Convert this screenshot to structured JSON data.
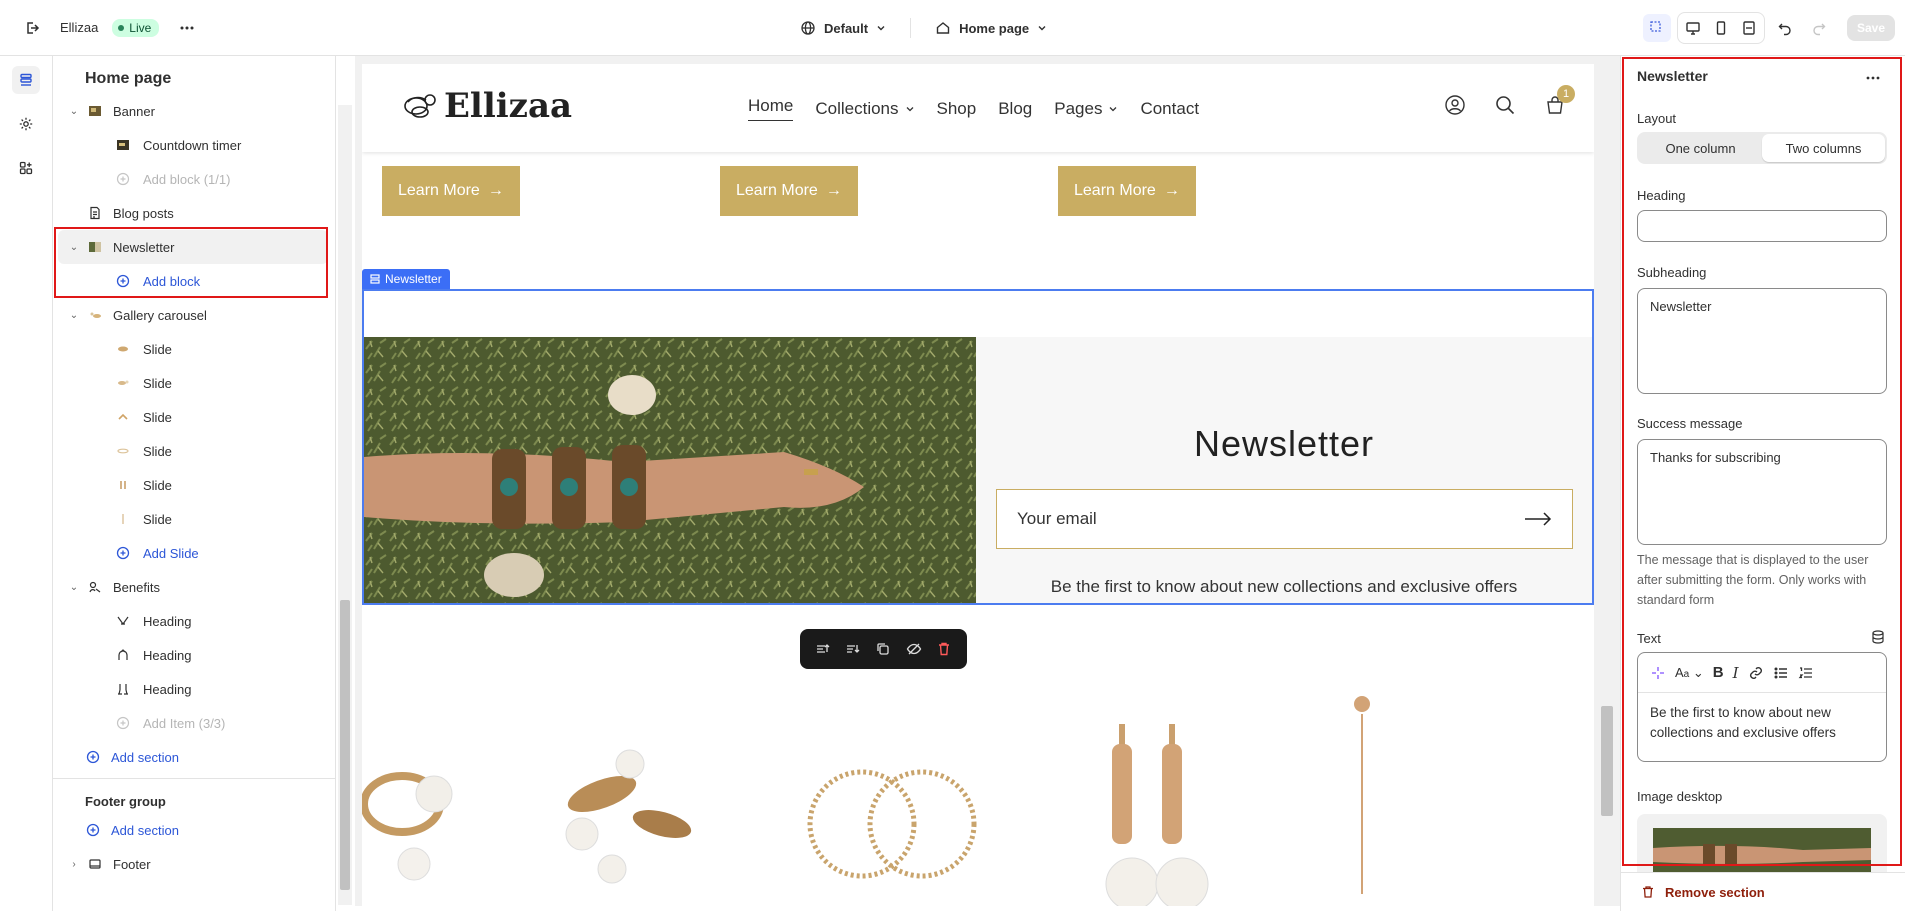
{
  "topbar": {
    "store_name": "Ellizaa",
    "status_badge": "Live",
    "theme_select": "Default",
    "page_select": "Home page",
    "save_label": "Save"
  },
  "sidebar": {
    "title": "Home page",
    "items": [
      {
        "label": "Banner",
        "kind": "section"
      },
      {
        "label": "Countdown timer",
        "kind": "child"
      },
      {
        "label": "Add block (1/1)",
        "kind": "add-disabled"
      },
      {
        "label": "Blog posts",
        "kind": "section"
      },
      {
        "label": "Newsletter",
        "kind": "section",
        "selected": true
      },
      {
        "label": "Add block",
        "kind": "add"
      },
      {
        "label": "Gallery carousel",
        "kind": "section"
      },
      {
        "label": "Slide",
        "kind": "child"
      },
      {
        "label": "Slide",
        "kind": "child"
      },
      {
        "label": "Slide",
        "kind": "child"
      },
      {
        "label": "Slide",
        "kind": "child"
      },
      {
        "label": "Slide",
        "kind": "child"
      },
      {
        "label": "Slide",
        "kind": "child"
      },
      {
        "label": "Add Slide",
        "kind": "add"
      },
      {
        "label": "Benefits",
        "kind": "section"
      },
      {
        "label": "Heading",
        "kind": "child"
      },
      {
        "label": "Heading",
        "kind": "child"
      },
      {
        "label": "Heading",
        "kind": "child"
      },
      {
        "label": "Add Item (3/3)",
        "kind": "add-disabled"
      },
      {
        "label": "Add section",
        "kind": "add-section"
      }
    ],
    "footer_group_title": "Footer group",
    "footer_add_section": "Add section",
    "footer_item": "Footer"
  },
  "preview": {
    "logo_text": "Ellizaa",
    "nav": [
      {
        "label": "Home",
        "dropdown": false
      },
      {
        "label": "Collections",
        "dropdown": true
      },
      {
        "label": "Shop",
        "dropdown": false
      },
      {
        "label": "Blog",
        "dropdown": false
      },
      {
        "label": "Pages",
        "dropdown": true
      },
      {
        "label": "Contact",
        "dropdown": false
      }
    ],
    "cart_count": "1",
    "learn_more": "Learn More",
    "section_tag": "Newsletter",
    "newsletter_heading": "Newsletter",
    "email_placeholder": "Your email",
    "newsletter_text": "Be the first to know about new collections and exclusive offers"
  },
  "panel": {
    "title": "Newsletter",
    "layout_label": "Layout",
    "layout_options": [
      "One column",
      "Two columns"
    ],
    "layout_selected": "Two columns",
    "heading_label": "Heading",
    "heading_value": "",
    "subheading_label": "Subheading",
    "subheading_value": "Newsletter",
    "success_label": "Success message",
    "success_value": "Thanks for subscribing",
    "success_help": "The message that is displayed to the user after submitting the form. Only works with standard form",
    "text_label": "Text",
    "text_value": "Be the first to know about new collections and exclusive offers",
    "image_label": "Image desktop",
    "remove_label": "Remove section"
  },
  "colors": {
    "accent_gold": "#c9ad62",
    "selection_blue": "#3b6ef6",
    "link_blue": "#2c56d7",
    "danger": "#8e1f0b"
  }
}
